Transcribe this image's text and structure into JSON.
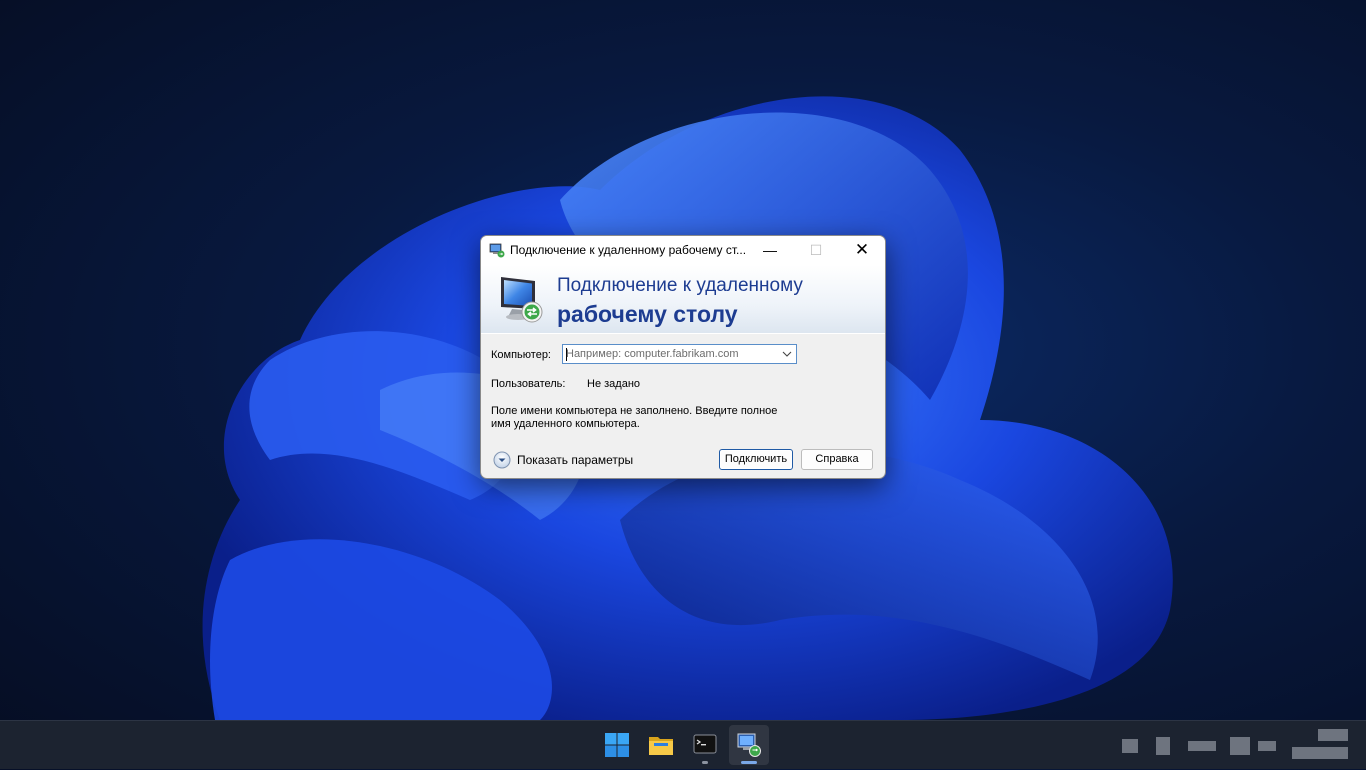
{
  "window": {
    "title": "Подключение к удаленному рабочему ст...",
    "minimize_glyph": "—",
    "maximize_glyph": "☐",
    "close_glyph": "✕",
    "icon": "remote-desktop-icon"
  },
  "banner": {
    "line1": "Подключение к удаленному",
    "line2": "рабочему столу",
    "icon": "remote-desktop-monitor-icon"
  },
  "form": {
    "computer_label": "Компьютер:",
    "computer_placeholder": "Например: computer.fabrikam.com",
    "computer_value": "",
    "user_label": "Пользователь:",
    "user_value": "Не задано",
    "message_line1": "Поле имени компьютера не заполнено. Введите полное",
    "message_line2": "имя удаленного компьютера."
  },
  "footer": {
    "show_options_label": "Показать параметры",
    "connect_label": "Подключить",
    "help_label": "Справка"
  },
  "taskbar": {
    "apps": [
      {
        "name": "start-button",
        "icon": "windows-logo-icon"
      },
      {
        "name": "file-explorer",
        "icon": "folder-icon"
      },
      {
        "name": "terminal",
        "icon": "terminal-icon"
      },
      {
        "name": "remote-desktop",
        "icon": "remote-desktop-icon",
        "active": true
      }
    ]
  },
  "colors": {
    "banner_text": "#1d3c91",
    "accent": "#1f5aa5",
    "taskbar_bg": "#1c2330"
  }
}
